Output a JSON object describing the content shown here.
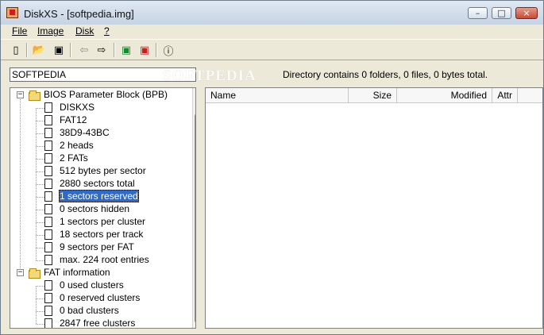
{
  "window": {
    "title": "DiskXS - [softpedia.img]"
  },
  "menu": [
    {
      "label": "File"
    },
    {
      "label": "Image"
    },
    {
      "label": "Disk"
    },
    {
      "label": "?"
    }
  ],
  "toolbar": {
    "buttons": [
      {
        "icon": "new-document-icon"
      },
      {
        "icon": "open-folder-icon"
      },
      {
        "icon": "save-icon"
      },
      {
        "icon": "import-icon"
      },
      {
        "icon": "export-icon"
      },
      {
        "icon": "green-disk-icon"
      },
      {
        "icon": "red-disk-icon"
      },
      {
        "icon": "info-icon"
      }
    ]
  },
  "path_input": {
    "value": "SOFTPEDIA"
  },
  "watermark": {
    "text": "SOFTPEDIA"
  },
  "status": {
    "text": "Directory contains 0 folders, 0 files, 0 bytes total."
  },
  "tree": {
    "groups": [
      {
        "label": "BIOS Parameter Block (BPB)",
        "items": [
          "DISKXS",
          "FAT12",
          "38D9-43BC",
          "2 heads",
          "2 FATs",
          "512 bytes per sector",
          "2880 sectors total",
          "1 sectors reserved",
          "0 sectors hidden",
          "1 sectors per cluster",
          "18 sectors per track",
          "9 sectors per FAT",
          "max. 224 root entries"
        ],
        "selected_item": "1 sectors reserved"
      },
      {
        "label": "FAT information",
        "items": [
          "0 used clusters",
          "0 reserved clusters",
          "0 bad clusters",
          "2847 free clusters"
        ]
      }
    ],
    "toggle_symbol": "−"
  },
  "list": {
    "columns": [
      "Name",
      "Size",
      "Modified",
      "Attr"
    ]
  },
  "colors": {
    "selection": "#316ac5",
    "window_bg": "#ece9d8"
  }
}
